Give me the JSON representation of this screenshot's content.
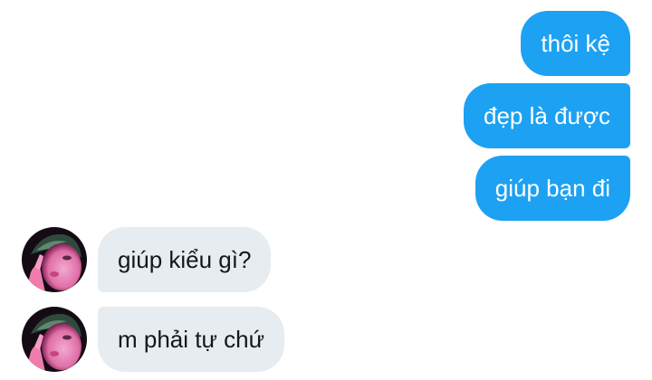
{
  "conversation": {
    "sent": [
      {
        "text": "thôi kệ"
      },
      {
        "text": "đẹp là được"
      },
      {
        "text": "giúp bạn đi"
      }
    ],
    "received": [
      {
        "text": "giúp kiểu gì?"
      },
      {
        "text": "m phải tự chứ"
      }
    ]
  },
  "colors": {
    "sent_bubble": "#1da1f2",
    "received_bubble": "#e6ecf0",
    "avatar_tone": "#e88ab8"
  }
}
